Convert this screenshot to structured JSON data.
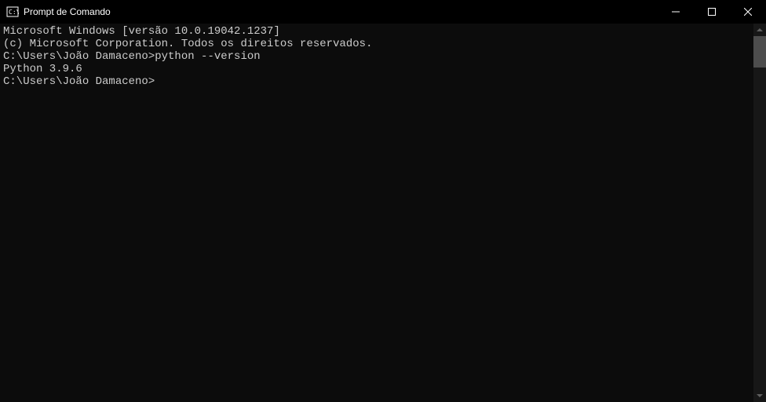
{
  "titlebar": {
    "title": "Prompt de Comando"
  },
  "terminal": {
    "line1": "Microsoft Windows [versão 10.0.19042.1237]",
    "line2": "(c) Microsoft Corporation. Todos os direitos reservados.",
    "line3": "",
    "line4": "C:\\Users\\João Damaceno>python --version",
    "line5": "Python 3.9.6",
    "line6": "",
    "line7": "C:\\Users\\João Damaceno>"
  }
}
